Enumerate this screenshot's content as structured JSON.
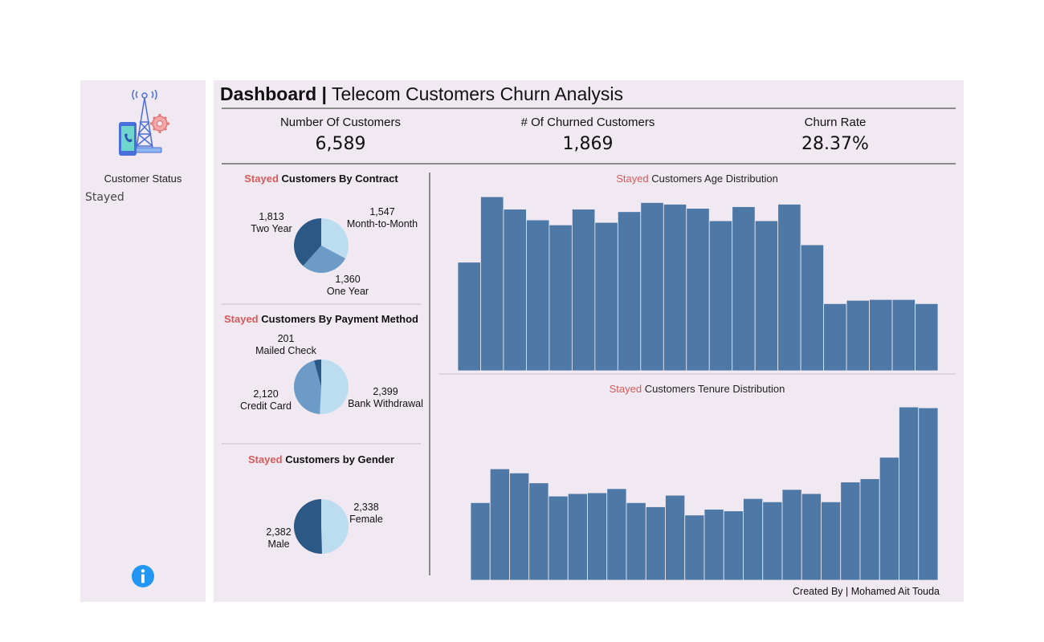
{
  "sidebar": {
    "logo_icon": "telecom-tower-phone-gear-icon",
    "filter_label": "Customer Status",
    "filter_value": "Stayed",
    "info_icon": "info-icon"
  },
  "header": {
    "title_bold": "Dashboard |",
    "title_rest": "Telecom Customers Churn Analysis"
  },
  "kpis": [
    {
      "label": "Number Of Customers",
      "value": "6,589"
    },
    {
      "label": "# Of Churned Customers",
      "value": "1,869"
    },
    {
      "label": "Churn Rate",
      "value": "28.37%"
    }
  ],
  "contract": {
    "prefix": "Stayed",
    "title": " Customers By Contract",
    "labels": [
      {
        "value": "1,547",
        "name": "Month-to-Month"
      },
      {
        "value": "1,813",
        "name": "Two Year"
      },
      {
        "value": "1,360",
        "name": "One Year"
      }
    ]
  },
  "payment": {
    "prefix": "Stayed",
    "title": " Customers By Payment Method",
    "labels": [
      {
        "value": "201",
        "name": "Mailed Check"
      },
      {
        "value": "2,120",
        "name": "Credit Card"
      },
      {
        "value": "2,399",
        "name": "Bank Withdrawal"
      }
    ]
  },
  "gender": {
    "prefix": "Stayed",
    "title": " Customers by Gender",
    "labels": [
      {
        "value": "2,338",
        "name": "Female"
      },
      {
        "value": "2,382",
        "name": "Male"
      }
    ]
  },
  "age": {
    "prefix": "Stayed",
    "title": " Customers Age Distribution"
  },
  "tenure": {
    "prefix": "Stayed",
    "title": " Customers Tenure Distribution"
  },
  "footer": "Created By | Mohamed Ait Touda",
  "colors": {
    "panel_bg": "#f1e9f2",
    "accent_red": "#d65a5a",
    "bar": "#4e79a7",
    "pie_dark": "#2c5886",
    "pie_mid": "#6b9bc6",
    "pie_light": "#bcdcf0",
    "info_blue": "#2196f3"
  },
  "chart_data": [
    {
      "type": "pie",
      "title": "Stayed Customers By Contract",
      "slices": [
        {
          "name": "Month-to-Month",
          "value": 1547,
          "color": "#bcdcf0"
        },
        {
          "name": "One Year",
          "value": 1360,
          "color": "#6b9bc6"
        },
        {
          "name": "Two Year",
          "value": 1813,
          "color": "#2c5886"
        }
      ]
    },
    {
      "type": "pie",
      "title": "Stayed Customers By Payment Method",
      "slices": [
        {
          "name": "Bank Withdrawal",
          "value": 2399,
          "color": "#bcdcf0"
        },
        {
          "name": "Credit Card",
          "value": 2120,
          "color": "#6b9bc6"
        },
        {
          "name": "Mailed Check",
          "value": 201,
          "color": "#2c5886"
        }
      ]
    },
    {
      "type": "pie",
      "title": "Stayed Customers by Gender",
      "slices": [
        {
          "name": "Female",
          "value": 2338,
          "color": "#bcdcf0"
        },
        {
          "name": "Male",
          "value": 2382,
          "color": "#2c5886"
        }
      ]
    },
    {
      "type": "bar",
      "title": "Stayed Customers Age Distribution",
      "values": [
        131,
        210,
        195,
        182,
        176,
        195,
        179,
        192,
        203,
        201,
        196,
        181,
        198,
        181,
        201,
        152,
        81,
        85,
        86,
        86,
        81
      ],
      "ylim": [
        0,
        215
      ]
    },
    {
      "type": "bar",
      "title": "Stayed Customers Tenure Distribution",
      "values": [
        94,
        135,
        130,
        118,
        102,
        105,
        106,
        111,
        94,
        89,
        103,
        79,
        86,
        84,
        99,
        95,
        110,
        105,
        95,
        119,
        123,
        149,
        210,
        209
      ],
      "ylim": [
        0,
        215
      ]
    }
  ]
}
